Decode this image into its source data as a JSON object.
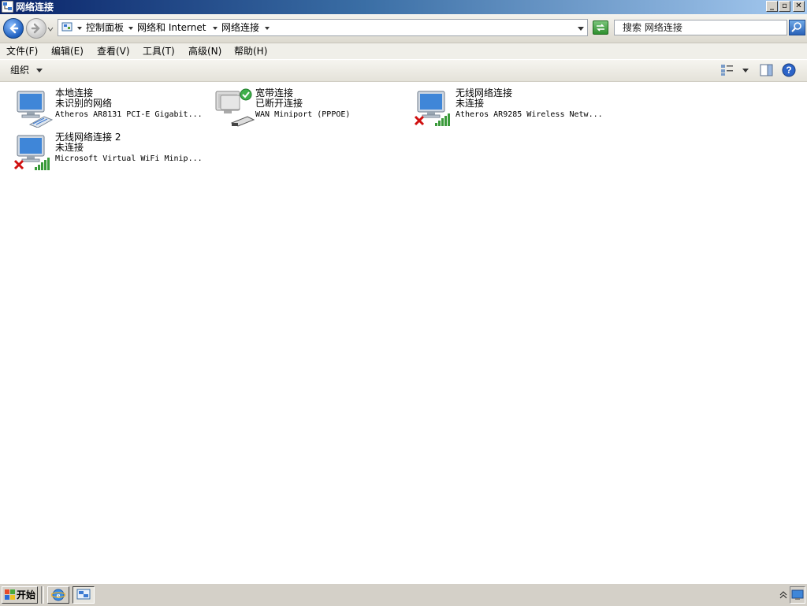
{
  "window": {
    "title": "网络连接"
  },
  "address": {
    "crumbs": [
      "控制面板",
      "网络和 Internet",
      "网络连接"
    ]
  },
  "search": {
    "placeholder": "搜索 网络连接"
  },
  "menu": [
    "文件(F)",
    "编辑(E)",
    "查看(V)",
    "工具(T)",
    "高级(N)",
    "帮助(H)"
  ],
  "toolbar": {
    "organize": "组织"
  },
  "connections": [
    {
      "name": "本地连接",
      "status": "未识别的网络",
      "device": "Atheros AR8131 PCI-E Gigabit...",
      "icon": "lan-icon"
    },
    {
      "name": "宽带连接",
      "status": "已断开连接",
      "device": "WAN Miniport (PPPOE)",
      "icon": "broadband-icon"
    },
    {
      "name": "无线网络连接",
      "status": "未连接",
      "device": "Atheros AR9285 Wireless Netw...",
      "icon": "wireless-icon"
    },
    {
      "name": "无线网络连接 2",
      "status": "未连接",
      "device": "Microsoft Virtual WiFi Minip...",
      "icon": "wireless-icon"
    }
  ],
  "taskbar": {
    "start_label": "开始"
  }
}
